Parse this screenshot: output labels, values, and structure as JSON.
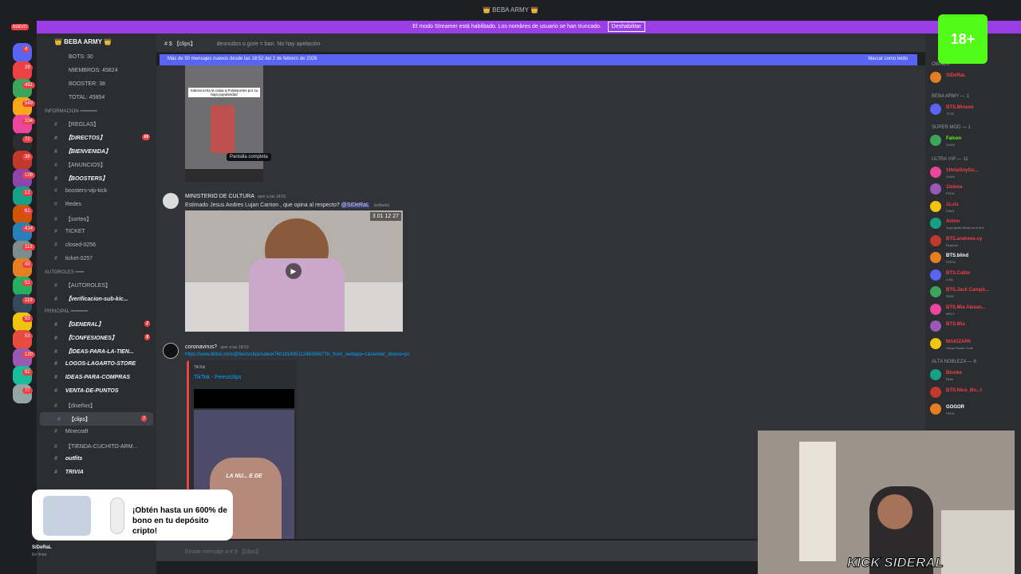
{
  "window": {
    "title": "👑 BEBA ARMY 👑"
  },
  "streamer_bar": {
    "message": "El modo Streamer está habilitado. Los nombres de usuario se han truncado.",
    "button": "Deshabilitar"
  },
  "guilds": {
    "new_label": "NUEVO",
    "badges": [
      "4",
      "29",
      "491",
      "549",
      "334",
      "72",
      "38",
      "126",
      "12",
      "61",
      "414",
      "113",
      "43",
      "51",
      "119",
      "93",
      "53",
      "120",
      "92",
      "77"
    ]
  },
  "server": {
    "name": "👑 BEBA ARMY 👑",
    "stats": [
      "BOTS: 30",
      "MIEMBROS: 45824",
      "BOOSTER: 38",
      "TOTAL: 45854"
    ],
    "categories": {
      "info": "INFORMACION ━━━━━━",
      "autoroles": "AUTOROLES ━━━",
      "principal": "PRINCIPAL ━━━━━━"
    },
    "channels_info": [
      {
        "label": "【REGLAS】",
        "bold": false,
        "count": ""
      },
      {
        "label": "【DIRECTOS】",
        "bold": true,
        "count": "69"
      },
      {
        "label": "【BIENVENIDA】",
        "bold": true,
        "count": ""
      },
      {
        "label": "【ANUNCIOS】",
        "bold": false,
        "count": ""
      },
      {
        "label": "【BOOSTERS】",
        "bold": true,
        "count": ""
      },
      {
        "label": "boosters-vip-kick",
        "bold": false,
        "count": ""
      },
      {
        "label": "Redes",
        "bold": false,
        "count": ""
      },
      {
        "label": "【sorteo】",
        "bold": false,
        "count": ""
      },
      {
        "label": "TICKET",
        "bold": false,
        "count": ""
      },
      {
        "label": "closed-0256",
        "bold": false,
        "count": ""
      },
      {
        "label": "ticket-0257",
        "bold": false,
        "count": ""
      }
    ],
    "channels_autoroles": [
      {
        "label": "【AUTOROLES】",
        "bold": false,
        "count": ""
      },
      {
        "label": "【verificacion-sub-kic...",
        "bold": true,
        "count": ""
      }
    ],
    "channels_principal": [
      {
        "label": "【GENERAL】",
        "bold": true,
        "count": "2"
      },
      {
        "label": "【CONFESIONES】",
        "bold": true,
        "count": "9"
      },
      {
        "label": "【IDEAS-PARA-LA-TIEN...",
        "bold": true,
        "count": ""
      },
      {
        "label": "LOGOS-LAGARTO-STORE",
        "bold": true,
        "count": ""
      },
      {
        "label": "IDEAS-PARA-COMPRAS",
        "bold": true,
        "count": ""
      },
      {
        "label": "VENTA-DE-PUNTOS",
        "bold": true,
        "count": ""
      },
      {
        "label": "【diseños】",
        "bold": false,
        "count": ""
      },
      {
        "label": "【clips】",
        "bold": false,
        "count": "2"
      },
      {
        "label": "Minecraft",
        "bold": false,
        "count": ""
      },
      {
        "label": "【TIENDA-CUCHITO-ARM...",
        "bold": false,
        "count": ""
      },
      {
        "label": "outfits",
        "bold": true,
        "count": ""
      },
      {
        "label": "TRIVIA",
        "bold": true,
        "count": ""
      }
    ]
  },
  "chat": {
    "channel": "【clips】",
    "topic": "desnudos o gore = ban. No hay apelación",
    "new_messages": "Más de 50 mensajes nuevos desde las 18:52 del 2 de febrero de 2026",
    "mark_read": "Marcar como leído",
    "first_video": {
      "caption": "Sideral echa la culpa a Poldeportes por su baja popularidad",
      "tooltip": "Pantalla completa"
    },
    "msg1": {
      "author": "MINISTERIO DE CULTURA",
      "time": "ayer a las 18:52",
      "text": "Estimado Jesus Andres Lujan Carrion , que opina al respecto?",
      "mention": "@SiDeRaL",
      "edited": "(editado)",
      "timer": "3 01 12 27"
    },
    "msg2": {
      "author": "coronavirus?",
      "time": "ayer a las 18:53",
      "link": "https://www.tiktok.com/@feenzclips/video/7601814351124635697?is_from_webapp=1&sender_device=pc",
      "embed_provider": "TikTok",
      "embed_title": "TikTok - Feenzclips",
      "overlay_text": "LA NU... E DE"
    },
    "composer": "Enviar mensaje a # $ 【clips】"
  },
  "members": {
    "groups": [
      {
        "label": "OWNER",
        "members": [
          {
            "name": "SiDeRaL",
            "status": "",
            "color": "#ed4245"
          }
        ]
      },
      {
        "label": "BEBA ARMY — 1",
        "members": [
          {
            "name": "BTS.Minami",
            "status": "TETA",
            "color": "#f23f43"
          }
        ]
      },
      {
        "label": "SUPER MOD — 1",
        "members": [
          {
            "name": "Falcen",
            "status": "GAAA",
            "color": "#53fc18"
          }
        ]
      },
      {
        "label": "ULTRA VIP — 11",
        "members": [
          {
            "name": "1HolaSoyGo...",
            "status": "GAAA",
            "color": "#ed4245"
          },
          {
            "name": "1Isleoa",
            "status": "FEKA",
            "color": "#ed4245"
          },
          {
            "name": "1Luis",
            "status": "RIMA",
            "color": "#ed4245"
          },
          {
            "name": "Anton",
            "status": "Juga gratis Abajo en el link",
            "color": "#ed4245"
          },
          {
            "name": "BTS.andreee.oy",
            "status": "Esperan",
            "color": "#ed4245"
          },
          {
            "name": "BTS.blind",
            "status": "GODA",
            "color": "#ffffff"
          },
          {
            "name": "BTS.Calito",
            "status": "Luffy",
            "color": "#ed4245"
          },
          {
            "name": "BTS.Jack Campb...",
            "status": "SEAF",
            "color": "#ed4245"
          },
          {
            "name": "BTS.Mia Alexan...",
            "status": "MOLY",
            "color": "#ed4245"
          },
          {
            "name": "BTS.Mia",
            "status": "",
            "color": "#ed4245"
          },
          {
            "name": "MAKIZAPA",
            "status": "Visual Studio Code",
            "color": "#ed4245"
          }
        ]
      },
      {
        "label": "ALTA NOBLEZA — 6",
        "members": [
          {
            "name": "Blonke",
            "status": "Bebs",
            "color": "#ed4245"
          },
          {
            "name": "BTS.Nico_Bo...t",
            "status": "",
            "color": "#ed4245"
          },
          {
            "name": "GOGOR",
            "status": "FEKA",
            "color": "#ffffff"
          }
        ]
      }
    ]
  },
  "user": {
    "name": "SiDeRaL",
    "status": "En línea"
  },
  "ad": {
    "text": "¡Obtén hasta un 600% de bono en tu depósito cripto!"
  },
  "overlay": {
    "age_badge": "18+",
    "kick_text": "KICK SIDERAL"
  }
}
